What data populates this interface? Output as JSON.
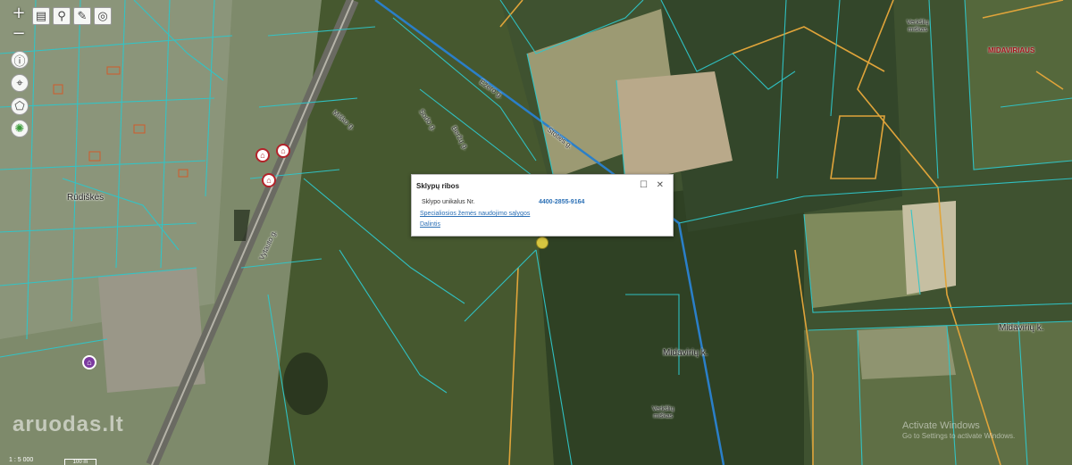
{
  "toolbar": {
    "zoom_in": "+",
    "zoom_out": "−",
    "icons": [
      "layers-icon",
      "pin-icon",
      "edit-icon",
      "target-icon"
    ]
  },
  "side_tools": [
    "info-icon",
    "locate-icon",
    "polygon-icon",
    "loading-icon"
  ],
  "map_labels": {
    "rudiskes": "Rūdiškės",
    "midaviriu_right": "Midavirių k.",
    "midaviriu_center": "Midavirių k.",
    "forest_top": "Verkšlių\nmiškas",
    "forest_bottom": "Verkšlių\nmiškas",
    "region_top_right": "MIDAVIRIAUS",
    "street_1": "Sodo g.",
    "street_2": "Beržų g.",
    "street_3": "Ežero g.",
    "street_4": "Vytauto g.",
    "street_5": "Miško g.",
    "street_6": "Stoties g."
  },
  "popup": {
    "title": "Sklypų ribos",
    "field_label": "Sklypo unikalus Nr.",
    "field_value": "4400-2855-9164",
    "link_1": "Specialiosios žemės naudojimo sąlygos",
    "link_2": "Dalintis"
  },
  "watermark": "aruodas.lt",
  "activate": {
    "title": "Activate Windows",
    "subtitle": "Go to Settings to activate Windows."
  },
  "scale": {
    "label": "1 : 5 000",
    "bar": "100 m"
  },
  "colors": {
    "parcel": "#2fc6c9",
    "road": "#e0a43a",
    "river": "#2a7fc9",
    "forest": "#2f4124"
  }
}
